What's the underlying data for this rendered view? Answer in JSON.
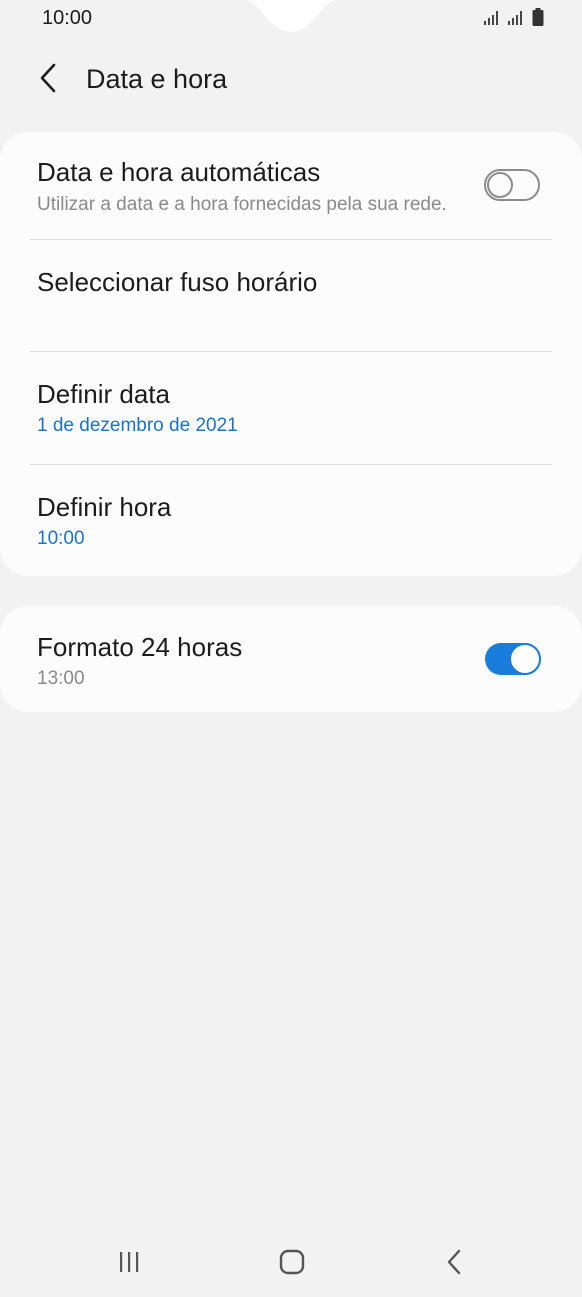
{
  "status_bar": {
    "time": "10:00"
  },
  "header": {
    "title": "Data e hora",
    "back_icon": "chevron-left-icon"
  },
  "settings": {
    "auto_datetime": {
      "title": "Data e hora automáticas",
      "subtitle": "Utilizar a data e a hora fornecidas pela sua rede.",
      "enabled": false
    },
    "timezone": {
      "title": "Seleccionar fuso horário"
    },
    "set_date": {
      "title": "Definir data",
      "value": "1 de dezembro de 2021"
    },
    "set_time": {
      "title": "Definir hora",
      "value": "10:00"
    },
    "format_24h": {
      "title": "Formato 24 horas",
      "subtitle": "13:00",
      "enabled": true
    }
  },
  "nav_bar": {
    "recents_icon": "recents-icon",
    "home_icon": "home-icon",
    "back_icon": "back-icon"
  },
  "colors": {
    "accent": "#1a7cdb",
    "link_text": "#1a73c9",
    "background": "#f2f2f2",
    "card": "#fcfcfc"
  }
}
